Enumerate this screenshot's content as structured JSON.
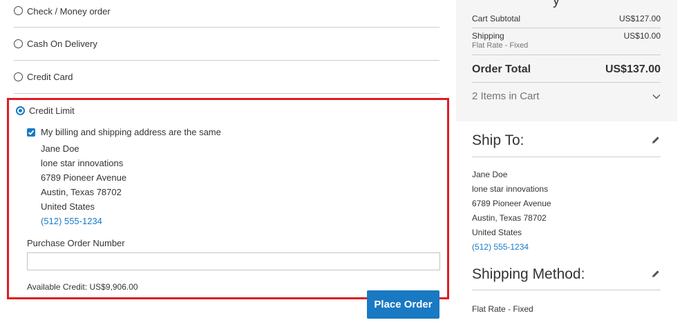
{
  "payment": {
    "methods": [
      {
        "label": "Check / Money order",
        "selected": false
      },
      {
        "label": "Cash On Delivery",
        "selected": false
      },
      {
        "label": "Credit Card",
        "selected": false
      },
      {
        "label": "Credit Limit",
        "selected": true
      }
    ],
    "same_address_label": "My billing and shipping address are the same",
    "same_address_checked": true,
    "billing_address": {
      "name": "Jane Doe",
      "company": "lone star innovations",
      "street": "6789 Pioneer Avenue",
      "city_line": "Austin, Texas 78702",
      "country": "United States",
      "phone": "(512) 555-1234"
    },
    "po_label": "Purchase Order Number",
    "po_value": "",
    "available_credit": "Available Credit: US$9,906.00",
    "place_order_label": "Place Order"
  },
  "summary": {
    "top_clip": "y",
    "cart_subtotal_label": "Cart Subtotal",
    "cart_subtotal_value": "US$127.00",
    "shipping_label": "Shipping",
    "shipping_value": "US$10.00",
    "shipping_method_sub": "Flat Rate - Fixed",
    "order_total_label": "Order Total",
    "order_total_value": "US$137.00",
    "items_in_cart": "2 Items in Cart"
  },
  "ship_to": {
    "title": "Ship To:",
    "name": "Jane Doe",
    "company": "lone star innovations",
    "street": "6789 Pioneer Avenue",
    "city_line": "Austin, Texas 78702",
    "country": "United States",
    "phone": "(512) 555-1234"
  },
  "shipping_method": {
    "title": "Shipping Method:",
    "value": "Flat Rate - Fixed"
  },
  "colors": {
    "accent": "#1979c3",
    "highlight_border": "#e11b22",
    "summary_bg": "#f5f5f5"
  }
}
